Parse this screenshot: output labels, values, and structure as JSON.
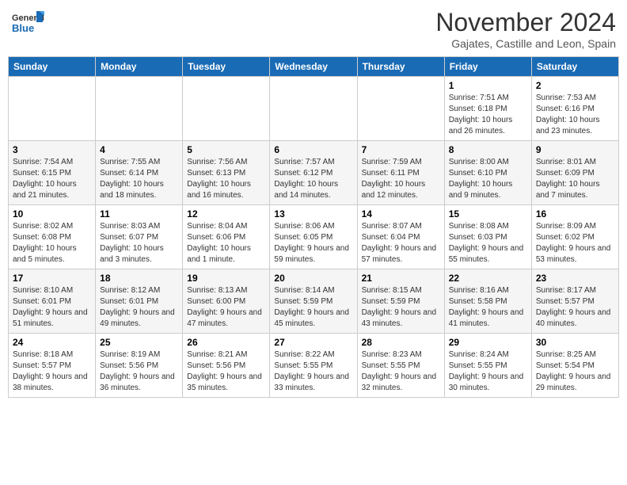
{
  "header": {
    "logo_line1": "General",
    "logo_line2": "Blue",
    "month": "November 2024",
    "location": "Gajates, Castille and Leon, Spain"
  },
  "weekdays": [
    "Sunday",
    "Monday",
    "Tuesday",
    "Wednesday",
    "Thursday",
    "Friday",
    "Saturday"
  ],
  "weeks": [
    [
      {
        "day": "",
        "info": ""
      },
      {
        "day": "",
        "info": ""
      },
      {
        "day": "",
        "info": ""
      },
      {
        "day": "",
        "info": ""
      },
      {
        "day": "",
        "info": ""
      },
      {
        "day": "1",
        "info": "Sunrise: 7:51 AM\nSunset: 6:18 PM\nDaylight: 10 hours and 26 minutes."
      },
      {
        "day": "2",
        "info": "Sunrise: 7:53 AM\nSunset: 6:16 PM\nDaylight: 10 hours and 23 minutes."
      }
    ],
    [
      {
        "day": "3",
        "info": "Sunrise: 7:54 AM\nSunset: 6:15 PM\nDaylight: 10 hours and 21 minutes."
      },
      {
        "day": "4",
        "info": "Sunrise: 7:55 AM\nSunset: 6:14 PM\nDaylight: 10 hours and 18 minutes."
      },
      {
        "day": "5",
        "info": "Sunrise: 7:56 AM\nSunset: 6:13 PM\nDaylight: 10 hours and 16 minutes."
      },
      {
        "day": "6",
        "info": "Sunrise: 7:57 AM\nSunset: 6:12 PM\nDaylight: 10 hours and 14 minutes."
      },
      {
        "day": "7",
        "info": "Sunrise: 7:59 AM\nSunset: 6:11 PM\nDaylight: 10 hours and 12 minutes."
      },
      {
        "day": "8",
        "info": "Sunrise: 8:00 AM\nSunset: 6:10 PM\nDaylight: 10 hours and 9 minutes."
      },
      {
        "day": "9",
        "info": "Sunrise: 8:01 AM\nSunset: 6:09 PM\nDaylight: 10 hours and 7 minutes."
      }
    ],
    [
      {
        "day": "10",
        "info": "Sunrise: 8:02 AM\nSunset: 6:08 PM\nDaylight: 10 hours and 5 minutes."
      },
      {
        "day": "11",
        "info": "Sunrise: 8:03 AM\nSunset: 6:07 PM\nDaylight: 10 hours and 3 minutes."
      },
      {
        "day": "12",
        "info": "Sunrise: 8:04 AM\nSunset: 6:06 PM\nDaylight: 10 hours and 1 minute."
      },
      {
        "day": "13",
        "info": "Sunrise: 8:06 AM\nSunset: 6:05 PM\nDaylight: 9 hours and 59 minutes."
      },
      {
        "day": "14",
        "info": "Sunrise: 8:07 AM\nSunset: 6:04 PM\nDaylight: 9 hours and 57 minutes."
      },
      {
        "day": "15",
        "info": "Sunrise: 8:08 AM\nSunset: 6:03 PM\nDaylight: 9 hours and 55 minutes."
      },
      {
        "day": "16",
        "info": "Sunrise: 8:09 AM\nSunset: 6:02 PM\nDaylight: 9 hours and 53 minutes."
      }
    ],
    [
      {
        "day": "17",
        "info": "Sunrise: 8:10 AM\nSunset: 6:01 PM\nDaylight: 9 hours and 51 minutes."
      },
      {
        "day": "18",
        "info": "Sunrise: 8:12 AM\nSunset: 6:01 PM\nDaylight: 9 hours and 49 minutes."
      },
      {
        "day": "19",
        "info": "Sunrise: 8:13 AM\nSunset: 6:00 PM\nDaylight: 9 hours and 47 minutes."
      },
      {
        "day": "20",
        "info": "Sunrise: 8:14 AM\nSunset: 5:59 PM\nDaylight: 9 hours and 45 minutes."
      },
      {
        "day": "21",
        "info": "Sunrise: 8:15 AM\nSunset: 5:59 PM\nDaylight: 9 hours and 43 minutes."
      },
      {
        "day": "22",
        "info": "Sunrise: 8:16 AM\nSunset: 5:58 PM\nDaylight: 9 hours and 41 minutes."
      },
      {
        "day": "23",
        "info": "Sunrise: 8:17 AM\nSunset: 5:57 PM\nDaylight: 9 hours and 40 minutes."
      }
    ],
    [
      {
        "day": "24",
        "info": "Sunrise: 8:18 AM\nSunset: 5:57 PM\nDaylight: 9 hours and 38 minutes."
      },
      {
        "day": "25",
        "info": "Sunrise: 8:19 AM\nSunset: 5:56 PM\nDaylight: 9 hours and 36 minutes."
      },
      {
        "day": "26",
        "info": "Sunrise: 8:21 AM\nSunset: 5:56 PM\nDaylight: 9 hours and 35 minutes."
      },
      {
        "day": "27",
        "info": "Sunrise: 8:22 AM\nSunset: 5:55 PM\nDaylight: 9 hours and 33 minutes."
      },
      {
        "day": "28",
        "info": "Sunrise: 8:23 AM\nSunset: 5:55 PM\nDaylight: 9 hours and 32 minutes."
      },
      {
        "day": "29",
        "info": "Sunrise: 8:24 AM\nSunset: 5:55 PM\nDaylight: 9 hours and 30 minutes."
      },
      {
        "day": "30",
        "info": "Sunrise: 8:25 AM\nSunset: 5:54 PM\nDaylight: 9 hours and 29 minutes."
      }
    ]
  ]
}
